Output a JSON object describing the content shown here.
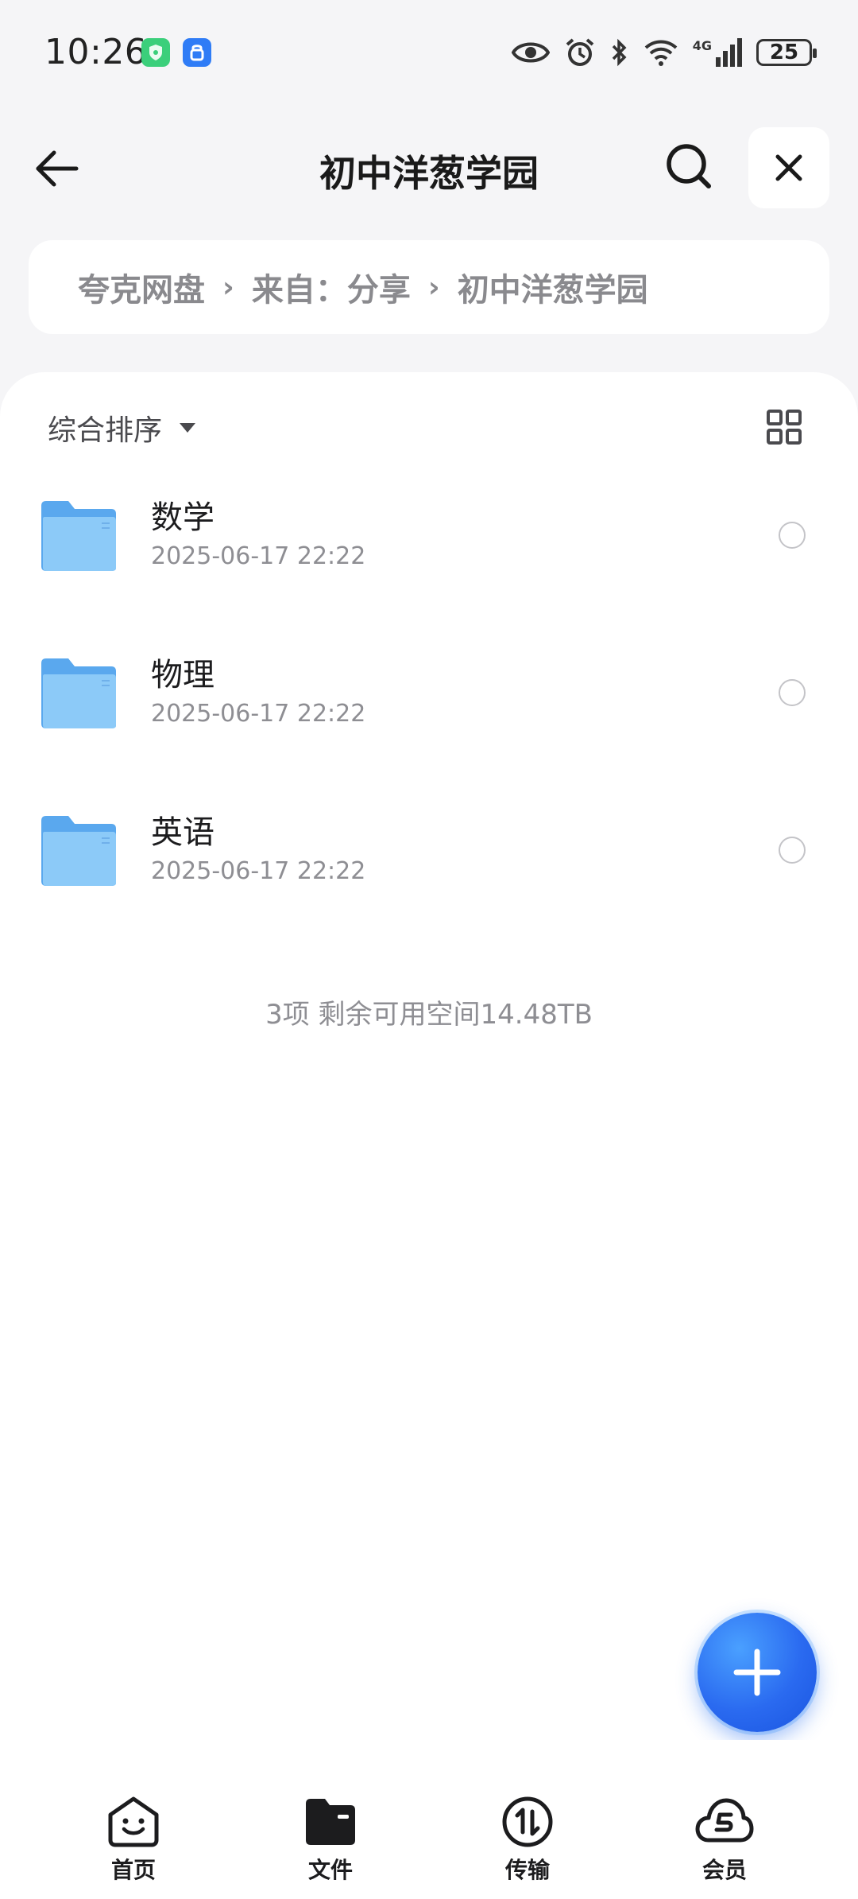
{
  "status_bar": {
    "time": "10:26",
    "network": "4G",
    "battery": "25"
  },
  "header": {
    "title": "初中洋葱学园"
  },
  "breadcrumb": {
    "items": [
      "夸克网盘",
      "来自：分享",
      "初中洋葱学园"
    ],
    "separator": "›"
  },
  "toolbar": {
    "sort_label": "综合排序"
  },
  "files": [
    {
      "name": "数学",
      "date": "2025-06-17 22:22"
    },
    {
      "name": "物理",
      "date": "2025-06-17 22:22"
    },
    {
      "name": "英语",
      "date": "2025-06-17 22:22"
    }
  ],
  "summary": "3项 剩余可用空间14.48TB",
  "nav": {
    "items": [
      {
        "label": "首页",
        "icon": "home-smile-icon"
      },
      {
        "label": "文件",
        "icon": "folder-card-icon"
      },
      {
        "label": "传输",
        "icon": "transfer-icon"
      },
      {
        "label": "会员",
        "icon": "cloud-member-icon"
      }
    ],
    "active_index": 1
  },
  "colors": {
    "accent": "#2a6af0",
    "folder": "#6fb7f5",
    "background": "#f5f5f7"
  }
}
